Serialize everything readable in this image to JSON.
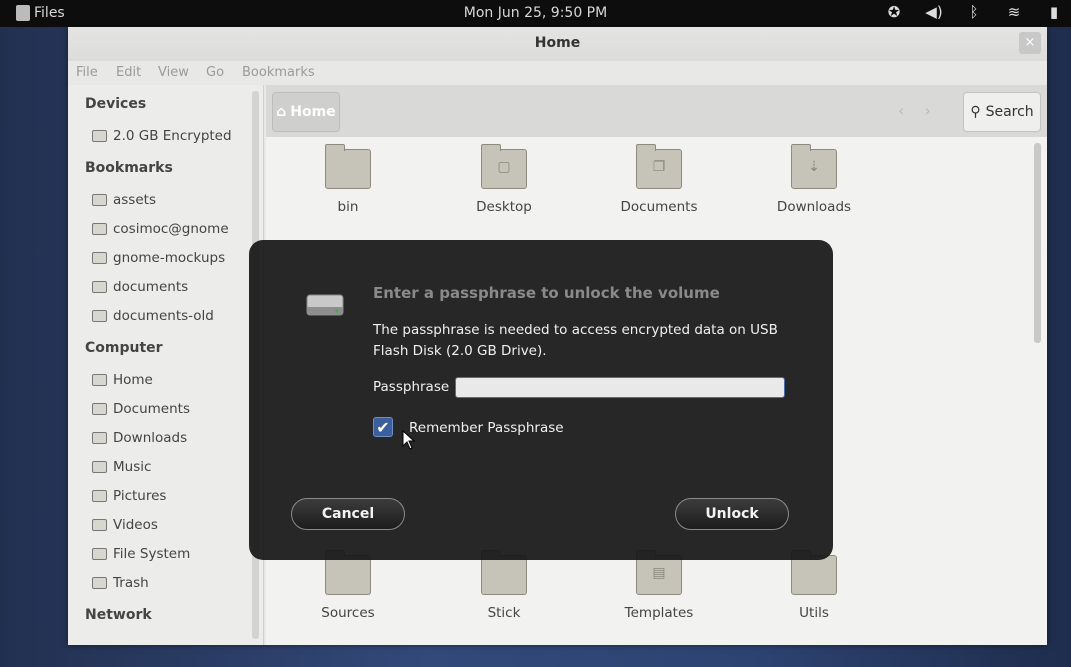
{
  "topbar": {
    "app_name": "Files",
    "clock": "Mon Jun 25,  9:50 PM",
    "tray_icons": [
      "accessibility-icon",
      "volume-icon",
      "bluetooth-icon",
      "wifi-icon",
      "battery-icon"
    ]
  },
  "window": {
    "title": "Home",
    "close_glyph": "×",
    "menu": [
      "File",
      "Edit",
      "View",
      "Go",
      "Bookmarks"
    ]
  },
  "sidebar": {
    "devices_heading": "Devices",
    "devices": [
      "2.0 GB Encrypted"
    ],
    "bookmarks_heading": "Bookmarks",
    "bookmarks": [
      "assets",
      "cosimoc@gnome",
      "gnome-mockups",
      "documents",
      "documents-old"
    ],
    "computer_heading": "Computer",
    "computer": [
      "Home",
      "Documents",
      "Downloads",
      "Music",
      "Pictures",
      "Videos",
      "File System",
      "Trash"
    ],
    "network_heading": "Network"
  },
  "toolbar": {
    "path_label": "Home",
    "search_label": "Search"
  },
  "files": {
    "row1": [
      "bin",
      "Desktop",
      "Documents",
      "Downloads"
    ],
    "row5": [
      "Sources",
      "Stick",
      "Templates",
      "Utils"
    ]
  },
  "dialog": {
    "title": "Enter a passphrase to unlock the volume",
    "message": "The passphrase is needed to access encrypted data on USB Flash Disk (2.0 GB Drive).",
    "passphrase_label": "Passphrase",
    "passphrase_value": "",
    "remember_label": "Remember Passphrase",
    "remember_checked": true,
    "cancel_label": "Cancel",
    "unlock_label": "Unlock"
  }
}
